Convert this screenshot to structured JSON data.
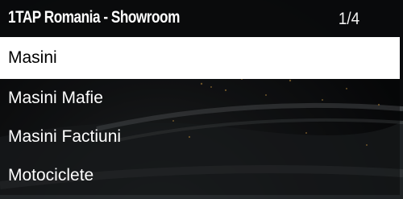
{
  "menu": {
    "title": "1TAP Romania - Showroom",
    "counter": "1/4",
    "selected_index": 0,
    "items": [
      {
        "label": "Masini"
      },
      {
        "label": "Masini Mafie"
      },
      {
        "label": "Masini Factiuni"
      },
      {
        "label": "Motociclete"
      }
    ]
  },
  "colors": {
    "header_bg": "#0a0b0c",
    "selected_bg": "#ffffff",
    "selected_text": "#000000",
    "item_text": "#ffffff"
  }
}
